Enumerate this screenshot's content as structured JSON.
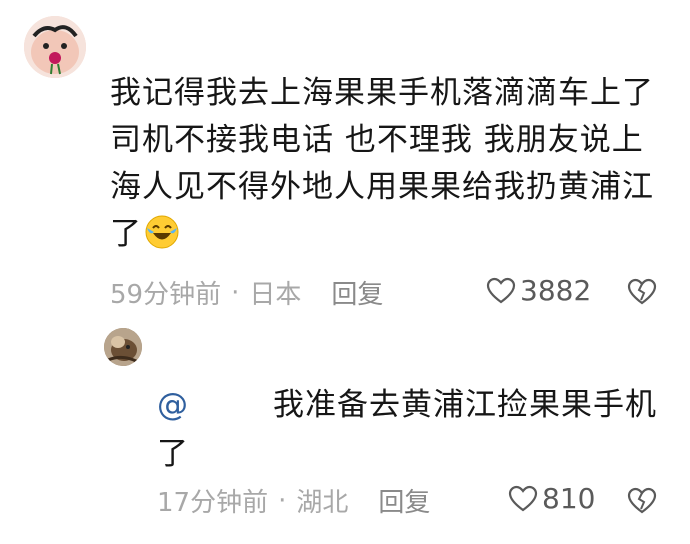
{
  "comment": {
    "text": "我记得我去上海果果手机落滴滴车上了司机不接我电话 也不理我 我朋友说上海人见不得外地人用果果给我扔黄浦江了",
    "emoji": "laughing-crying-emoji",
    "time": "59分钟前",
    "location": "日本",
    "reply_label": "回复",
    "likes": "3882"
  },
  "reply": {
    "mention": "@",
    "text": "我准备去黄浦江捡果果手机了",
    "time": "17分钟前",
    "location": "湖北",
    "reply_label": "回复",
    "likes": "810"
  },
  "separator": "·",
  "icons": {
    "like": "heart-outline-icon",
    "dislike": "broken-heart-icon"
  }
}
